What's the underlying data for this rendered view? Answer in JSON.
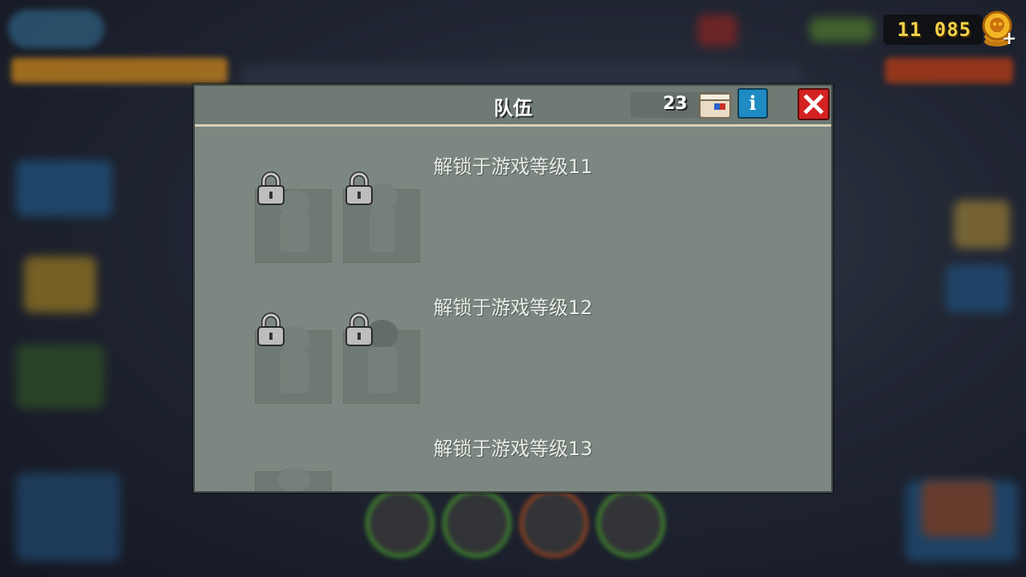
{
  "hud": {
    "coins": "11 085"
  },
  "panel": {
    "title": "队伍",
    "box_count": "23",
    "info_label": "i",
    "sections": [
      {
        "title": "解锁于游戏等级11"
      },
      {
        "title": "解锁于游戏等级12"
      },
      {
        "title": "解锁于游戏等级13"
      }
    ]
  },
  "icons": {
    "coin": "skull-coin-icon",
    "box": "supply-box-icon",
    "info": "info-icon",
    "close": "close-icon",
    "lock": "lock-icon"
  },
  "colors": {
    "panel_bg": "#7c8781",
    "header_bg": "#6f7a74",
    "info_blue": "#1f8bc2",
    "close_red": "#d42222",
    "coin_yellow": "#f3d24a"
  }
}
